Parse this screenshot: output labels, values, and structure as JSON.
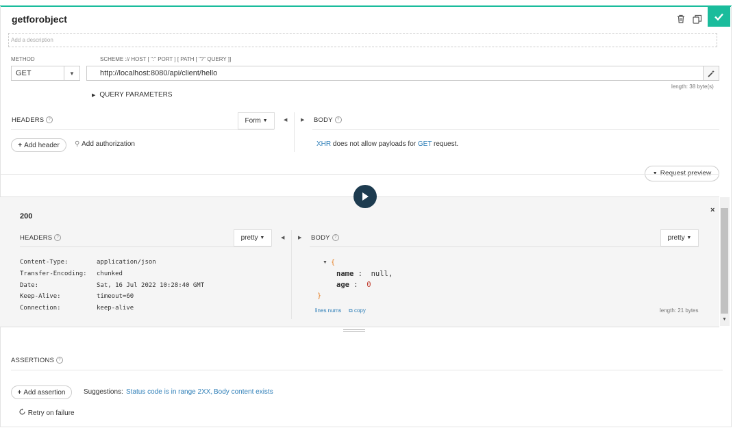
{
  "request": {
    "title": "getforobject",
    "description_placeholder": "Add a description",
    "method_label": "METHOD",
    "method": "GET",
    "url_label": "SCHEME :// HOST [ \":\" PORT ] [ PATH [ \"?\" QUERY ]]",
    "url": "http://localhost:8080/api/client/hello",
    "url_length": "length: 38 byte(s)",
    "query_params_label": "QUERY PARAMETERS",
    "headers_label": "HEADERS",
    "form_label": "Form",
    "add_header_label": "Add header",
    "add_authorization_label": "Add authorization",
    "body_label": "BODY",
    "body_message": {
      "xhr": "XHR",
      "middle": " does not allow payloads for ",
      "get": "GET",
      "end": " request."
    },
    "request_preview_label": "Request preview"
  },
  "response": {
    "status": "200",
    "headers_label": "HEADERS",
    "headers_format": "pretty",
    "headers": [
      {
        "name": "Content-Type:",
        "value": "application/json"
      },
      {
        "name": "Transfer-Encoding:",
        "value": "chunked"
      },
      {
        "name": "Date:",
        "value": "Sat, 16 Jul 2022 10:28:40 GMT"
      },
      {
        "name": "Keep-Alive:",
        "value": "timeout=60"
      },
      {
        "name": "Connection:",
        "value": "keep-alive"
      }
    ],
    "body_label": "BODY",
    "body_format": "pretty",
    "body_json": {
      "open": "{",
      "line1_key": "name",
      "line1_sep": " :  ",
      "line1_val": "null,",
      "line2_key": "age",
      "line2_sep": " :  ",
      "line2_val": "0",
      "close": "}"
    },
    "line_nums_label": "lines nums",
    "copy_label": "copy",
    "body_length": "length: 21 bytes"
  },
  "assertions": {
    "label": "ASSERTIONS",
    "add_assertion_label": "Add assertion",
    "suggestions_label": "Suggestions:",
    "suggestion1": "Status code is in range 2XX,",
    "suggestion2": "Body content exists",
    "retry_label": "Retry on failure"
  },
  "colors": {
    "accent": "#1abc9c",
    "link": "#2f7fb8",
    "play": "#1d3b4f",
    "json_number": "#c0392b",
    "json_brace": "#e67e22"
  },
  "icons": [
    "trash-icon",
    "duplicate-icon",
    "check-icon",
    "caret-down-icon",
    "magic-wand-icon",
    "triangle-right-icon",
    "triangle-left-icon",
    "plus-icon",
    "key-icon",
    "play-icon",
    "close-icon",
    "copy-icon",
    "refresh-icon",
    "help-icon"
  ]
}
